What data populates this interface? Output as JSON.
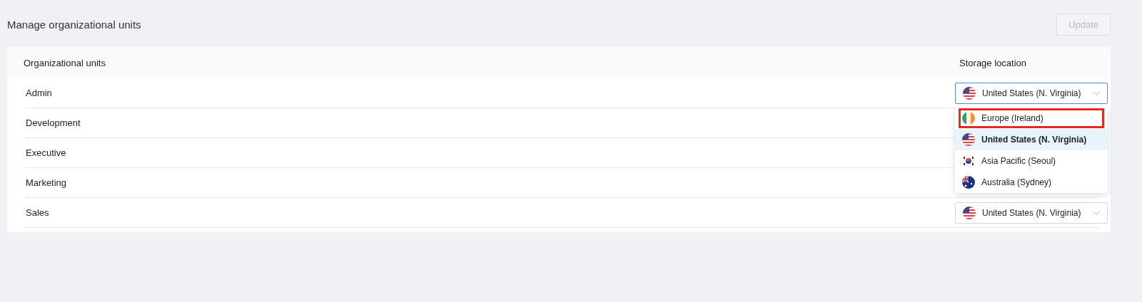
{
  "title": "Manage organizational units",
  "update_button": {
    "label": "Update",
    "disabled": true
  },
  "table": {
    "columns": [
      "Organizational units",
      "Storage location"
    ],
    "rows": [
      {
        "name": "Admin",
        "select": {
          "value": "United States (N. Virginia)",
          "kind": "us",
          "focused": true,
          "options": [
            {
              "label": "Europe (Ireland)",
              "kind": "ie",
              "selected": false,
              "highlighted": true
            },
            {
              "label": "United States (N. Virginia)",
              "kind": "us",
              "selected": true,
              "highlighted": false
            },
            {
              "label": "Asia Pacific (Seoul)",
              "kind": "kr",
              "selected": false,
              "highlighted": false
            },
            {
              "label": "Australia (Sydney)",
              "kind": "au",
              "selected": false,
              "highlighted": false
            }
          ]
        }
      },
      {
        "name": "Development"
      },
      {
        "name": "Executive"
      },
      {
        "name": "Marketing"
      },
      {
        "name": "Sales",
        "select": {
          "value": "United States (N. Virginia)",
          "kind": "us",
          "focused": false
        }
      }
    ]
  }
}
